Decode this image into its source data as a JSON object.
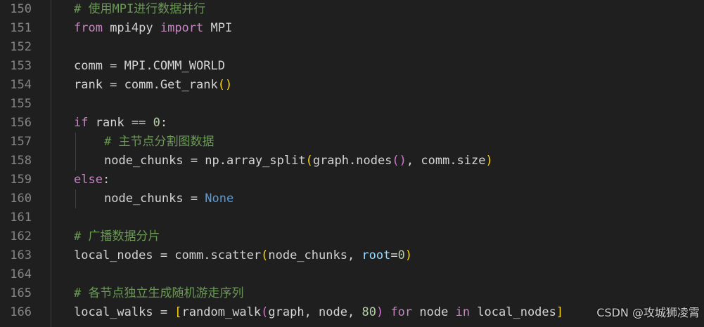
{
  "lines": [
    {
      "no": "150",
      "indent": 0,
      "tokens": [
        {
          "t": "# 使用MPI进行数据并行",
          "c": "cm"
        }
      ]
    },
    {
      "no": "151",
      "indent": 0,
      "tokens": [
        {
          "t": "from",
          "c": "kw"
        },
        {
          "t": " mpi4py ",
          "c": "plain"
        },
        {
          "t": "import",
          "c": "kw"
        },
        {
          "t": " MPI",
          "c": "plain"
        }
      ]
    },
    {
      "no": "152",
      "indent": 0,
      "tokens": []
    },
    {
      "no": "153",
      "indent": 0,
      "tokens": [
        {
          "t": "comm = MPI.COMM_WORLD",
          "c": "plain"
        }
      ]
    },
    {
      "no": "154",
      "indent": 0,
      "tokens": [
        {
          "t": "rank = comm.Get_rank",
          "c": "plain"
        },
        {
          "t": "()",
          "c": "br1"
        }
      ]
    },
    {
      "no": "155",
      "indent": 0,
      "tokens": []
    },
    {
      "no": "156",
      "indent": 0,
      "tokens": [
        {
          "t": "if",
          "c": "kw"
        },
        {
          "t": " rank == ",
          "c": "plain"
        },
        {
          "t": "0",
          "c": "num"
        },
        {
          "t": ":",
          "c": "plain"
        }
      ]
    },
    {
      "no": "157",
      "indent": 1,
      "tokens": [
        {
          "t": "# 主节点分割图数据",
          "c": "cm"
        }
      ]
    },
    {
      "no": "158",
      "indent": 1,
      "tokens": [
        {
          "t": "node_chunks = np.array_split",
          "c": "plain"
        },
        {
          "t": "(",
          "c": "br1"
        },
        {
          "t": "graph.nodes",
          "c": "plain"
        },
        {
          "t": "()",
          "c": "br2"
        },
        {
          "t": ", comm.size",
          "c": "plain"
        },
        {
          "t": ")",
          "c": "br1"
        }
      ]
    },
    {
      "no": "159",
      "indent": 0,
      "tokens": [
        {
          "t": "else",
          "c": "kw"
        },
        {
          "t": ":",
          "c": "plain"
        }
      ]
    },
    {
      "no": "160",
      "indent": 1,
      "tokens": [
        {
          "t": "node_chunks = ",
          "c": "plain"
        },
        {
          "t": "None",
          "c": "const"
        }
      ]
    },
    {
      "no": "161",
      "indent": 0,
      "tokens": []
    },
    {
      "no": "162",
      "indent": 0,
      "tokens": [
        {
          "t": "# 广播数据分片",
          "c": "cm"
        }
      ]
    },
    {
      "no": "163",
      "indent": 0,
      "tokens": [
        {
          "t": "local_nodes = comm.scatter",
          "c": "plain"
        },
        {
          "t": "(",
          "c": "br1"
        },
        {
          "t": "node_chunks, ",
          "c": "plain"
        },
        {
          "t": "root",
          "c": "id"
        },
        {
          "t": "=",
          "c": "plain"
        },
        {
          "t": "0",
          "c": "num"
        },
        {
          "t": ")",
          "c": "br1"
        }
      ]
    },
    {
      "no": "164",
      "indent": 0,
      "tokens": []
    },
    {
      "no": "165",
      "indent": 0,
      "tokens": [
        {
          "t": "# 各节点独立生成随机游走序列",
          "c": "cm"
        }
      ]
    },
    {
      "no": "166",
      "indent": 0,
      "tokens": [
        {
          "t": "local_walks = ",
          "c": "plain"
        },
        {
          "t": "[",
          "c": "br1"
        },
        {
          "t": "random_walk",
          "c": "plain"
        },
        {
          "t": "(",
          "c": "br2"
        },
        {
          "t": "graph, node, ",
          "c": "plain"
        },
        {
          "t": "80",
          "c": "num"
        },
        {
          "t": ")",
          "c": "br2"
        },
        {
          "t": " ",
          "c": "plain"
        },
        {
          "t": "for",
          "c": "kw"
        },
        {
          "t": " node ",
          "c": "plain"
        },
        {
          "t": "in",
          "c": "kw"
        },
        {
          "t": " local_nodes",
          "c": "plain"
        },
        {
          "t": "]",
          "c": "br1"
        }
      ]
    }
  ],
  "watermark": "CSDN @攻城狮凌霄"
}
